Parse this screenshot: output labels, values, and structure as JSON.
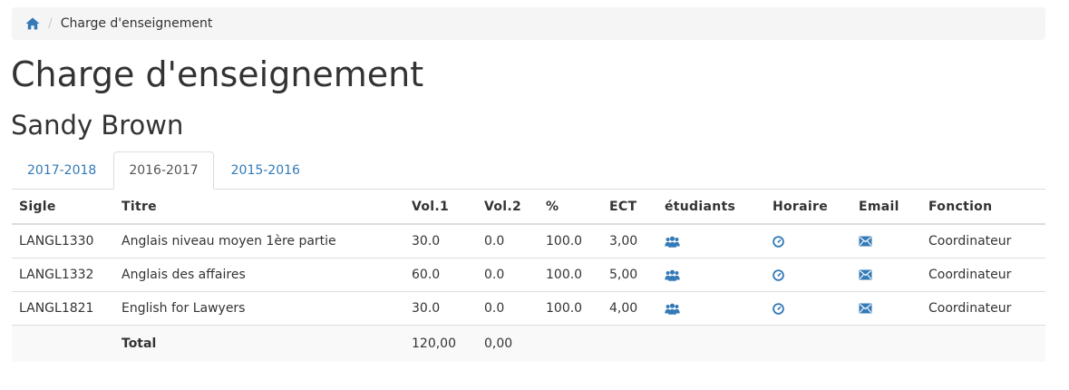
{
  "breadcrumb": {
    "home_icon": "home-icon",
    "separator": "/",
    "current": "Charge d'enseignement"
  },
  "page_title": "Charge d'enseignement",
  "person_name": "Sandy Brown",
  "tabs": [
    {
      "label": "2017-2018",
      "active": false
    },
    {
      "label": "2016-2017",
      "active": true
    },
    {
      "label": "2015-2016",
      "active": false
    }
  ],
  "table": {
    "headers": [
      "Sigle",
      "Titre",
      "Vol.1",
      "Vol.2",
      "%",
      "ECT",
      "étudiants",
      "Horaire",
      "Email",
      "Fonction"
    ],
    "rows": [
      {
        "sigle": "LANGL1330",
        "titre": "Anglais niveau moyen 1ère partie",
        "vol1": "30.0",
        "vol2": "0.0",
        "pct": "100.0",
        "ect": "3,00",
        "etudiants_icon": "users-icon",
        "horaire_icon": "clock-icon",
        "email_icon": "envelope-icon",
        "fonction": "Coordinateur"
      },
      {
        "sigle": "LANGL1332",
        "titre": "Anglais des affaires",
        "vol1": "60.0",
        "vol2": "0.0",
        "pct": "100.0",
        "ect": "5,00",
        "etudiants_icon": "users-icon",
        "horaire_icon": "clock-icon",
        "email_icon": "envelope-icon",
        "fonction": "Coordinateur"
      },
      {
        "sigle": "LANGL1821",
        "titre": "English for Lawyers",
        "vol1": "30.0",
        "vol2": "0.0",
        "pct": "100.0",
        "ect": "4,00",
        "etudiants_icon": "users-icon",
        "horaire_icon": "clock-icon",
        "email_icon": "envelope-icon",
        "fonction": "Coordinateur"
      }
    ],
    "total": {
      "label": "Total",
      "vol1": "120,00",
      "vol2": "0,00"
    }
  },
  "colors": {
    "link": "#337ab7",
    "text": "#333333",
    "breadcrumb_bg": "#f5f5f5",
    "border": "#dddddd"
  }
}
